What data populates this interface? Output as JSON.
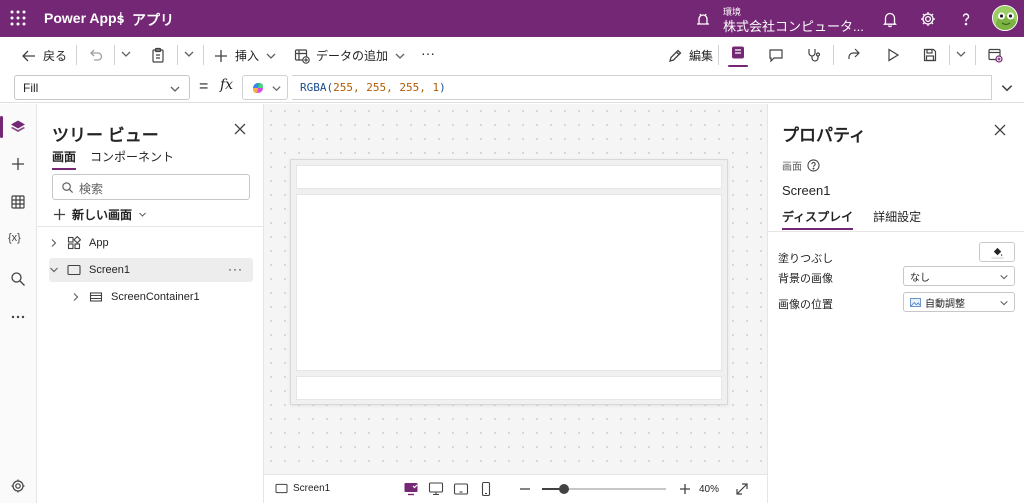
{
  "app": {
    "brand": "Power Apps",
    "separator": "|",
    "title": "アプリ",
    "environment_label": "環境",
    "environment_name": "株式会社コンピュータ..."
  },
  "toolbar": {
    "back": "戻る",
    "insert": "挿入",
    "add_data": "データの追加",
    "more": "···",
    "edit": "編集"
  },
  "formula_bar": {
    "property": "Fill",
    "equals": "=",
    "fx": "fx",
    "formula_func": "RGBA(",
    "formula_args": "255, 255, 255, 1",
    "formula_close": ")"
  },
  "tree_view": {
    "title": "ツリー ビュー",
    "tabs": [
      "画面",
      "コンポーネント"
    ],
    "search_placeholder": "検索",
    "new_screen": "新しい画面",
    "items": [
      {
        "label": "App"
      },
      {
        "label": "Screen1"
      },
      {
        "label": "ScreenContainer1"
      }
    ],
    "more": "···"
  },
  "status_bar": {
    "screen_name": "Screen1",
    "zoom": "40%",
    "zoom_level": 0.4
  },
  "properties": {
    "title": "プロパティ",
    "type": "画面",
    "screen_name": "Screen1",
    "tabs": [
      "ディスプレイ",
      "詳細設定"
    ],
    "fill_label": "塗りつぶし",
    "background_image_label": "背景の画像",
    "background_image_value": "なし",
    "image_position_label": "画像の位置",
    "image_position_value": "自動調整"
  },
  "colors": {
    "brand": "#742774",
    "avatar": "#8bc34a"
  }
}
